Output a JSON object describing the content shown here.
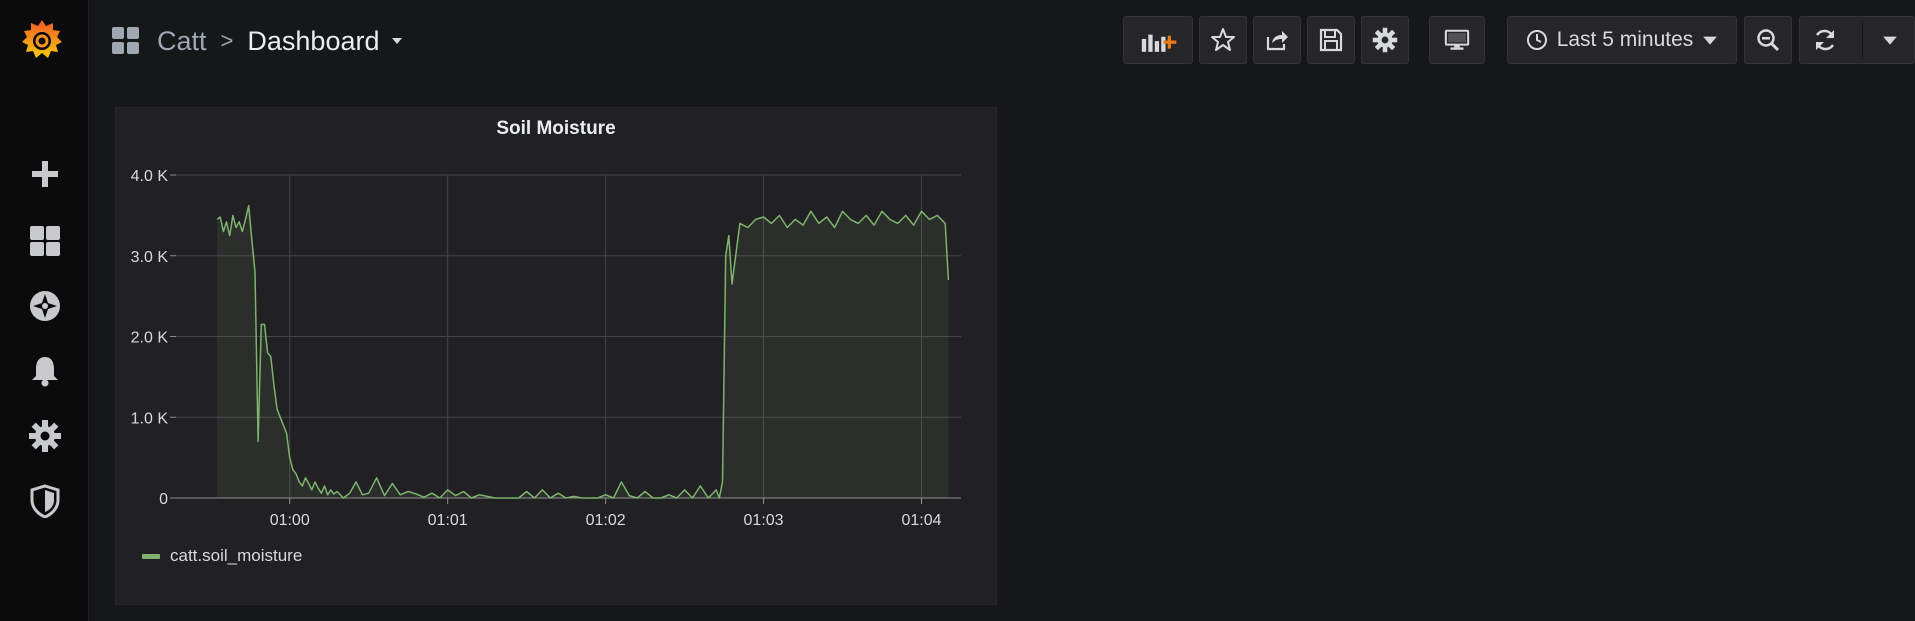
{
  "sidebar": {
    "logo_icon": "grafana-logo-icon",
    "items": [
      {
        "icon": "plus-icon"
      },
      {
        "icon": "dashboards-icon"
      },
      {
        "icon": "compass-icon"
      },
      {
        "icon": "bell-icon"
      },
      {
        "icon": "gear-icon"
      },
      {
        "icon": "shield-icon"
      }
    ]
  },
  "header": {
    "folder": "Catt",
    "separator": ">",
    "dashboard_title": "Dashboard",
    "time_range_label": "Last 5 minutes",
    "toolbar_icons": [
      "add-panel-icon",
      "star-icon",
      "share-icon",
      "save-icon",
      "settings-icon",
      "tv-mode-icon",
      "clock-icon",
      "zoom-out-icon",
      "refresh-icon",
      "refresh-interval-caret-icon"
    ]
  },
  "colors": {
    "series": "#7eb26d",
    "accent": "#eb7b18",
    "background": "#161719",
    "panel": "#212124"
  },
  "panel": {
    "title": "Soil Moisture"
  },
  "chart_data": {
    "type": "area",
    "title": "Soil Moisture",
    "x_tick_labels": [
      "01:00",
      "01:01",
      "01:02",
      "01:03",
      "01:04"
    ],
    "x_range_minutes": [
      -0.72,
      4.25
    ],
    "y_tick_labels": [
      "0",
      "1.0 K",
      "2.0 K",
      "3.0 K",
      "4.0 K"
    ],
    "ylim": [
      0,
      4000
    ],
    "grid": true,
    "legend_position": "bottom-left",
    "series": [
      {
        "name": "catt.soil_moisture",
        "color": "#7eb26d",
        "x_minutes": [
          -0.46,
          -0.44,
          -0.42,
          -0.4,
          -0.38,
          -0.36,
          -0.34,
          -0.32,
          -0.3,
          -0.28,
          -0.26,
          -0.24,
          -0.22,
          -0.2,
          -0.18,
          -0.16,
          -0.14,
          -0.12,
          -0.1,
          -0.08,
          -0.06,
          -0.04,
          -0.02,
          0.0,
          0.02,
          0.04,
          0.06,
          0.08,
          0.1,
          0.12,
          0.14,
          0.16,
          0.18,
          0.2,
          0.22,
          0.24,
          0.26,
          0.28,
          0.3,
          0.34,
          0.38,
          0.42,
          0.46,
          0.5,
          0.55,
          0.6,
          0.65,
          0.7,
          0.75,
          0.8,
          0.85,
          0.9,
          0.95,
          1.0,
          1.05,
          1.1,
          1.15,
          1.2,
          1.25,
          1.3,
          1.35,
          1.4,
          1.45,
          1.5,
          1.55,
          1.6,
          1.65,
          1.7,
          1.75,
          1.8,
          1.85,
          1.9,
          1.95,
          2.0,
          2.05,
          2.1,
          2.15,
          2.2,
          2.25,
          2.3,
          2.35,
          2.4,
          2.45,
          2.5,
          2.55,
          2.6,
          2.65,
          2.7,
          2.72,
          2.74,
          2.76,
          2.78,
          2.8,
          2.85,
          2.9,
          2.95,
          3.0,
          3.05,
          3.1,
          3.15,
          3.2,
          3.25,
          3.3,
          3.35,
          3.4,
          3.45,
          3.5,
          3.55,
          3.6,
          3.65,
          3.7,
          3.75,
          3.8,
          3.85,
          3.9,
          3.95,
          4.0,
          4.05,
          4.1,
          4.15,
          4.17
        ],
        "values": [
          3450,
          3480,
          3300,
          3420,
          3250,
          3500,
          3350,
          3420,
          3300,
          3450,
          3620,
          3200,
          2800,
          700,
          2150,
          2150,
          1800,
          1750,
          1400,
          1100,
          1000,
          900,
          800,
          500,
          350,
          300,
          200,
          150,
          250,
          180,
          100,
          200,
          120,
          60,
          150,
          40,
          100,
          50,
          80,
          0,
          60,
          200,
          40,
          60,
          250,
          30,
          180,
          40,
          80,
          50,
          10,
          60,
          0,
          100,
          30,
          80,
          0,
          40,
          20,
          0,
          0,
          0,
          0,
          80,
          0,
          100,
          0,
          60,
          0,
          20,
          0,
          0,
          0,
          40,
          0,
          200,
          30,
          0,
          80,
          0,
          0,
          40,
          0,
          100,
          0,
          150,
          0,
          100,
          0,
          200,
          3000,
          3250,
          2650,
          3400,
          3350,
          3450,
          3480,
          3400,
          3500,
          3350,
          3450,
          3380,
          3550,
          3400,
          3480,
          3350,
          3550,
          3450,
          3400,
          3500,
          3380,
          3550,
          3450,
          3400,
          3500,
          3380,
          3550,
          3450,
          3500,
          3400,
          2700
        ]
      }
    ]
  }
}
